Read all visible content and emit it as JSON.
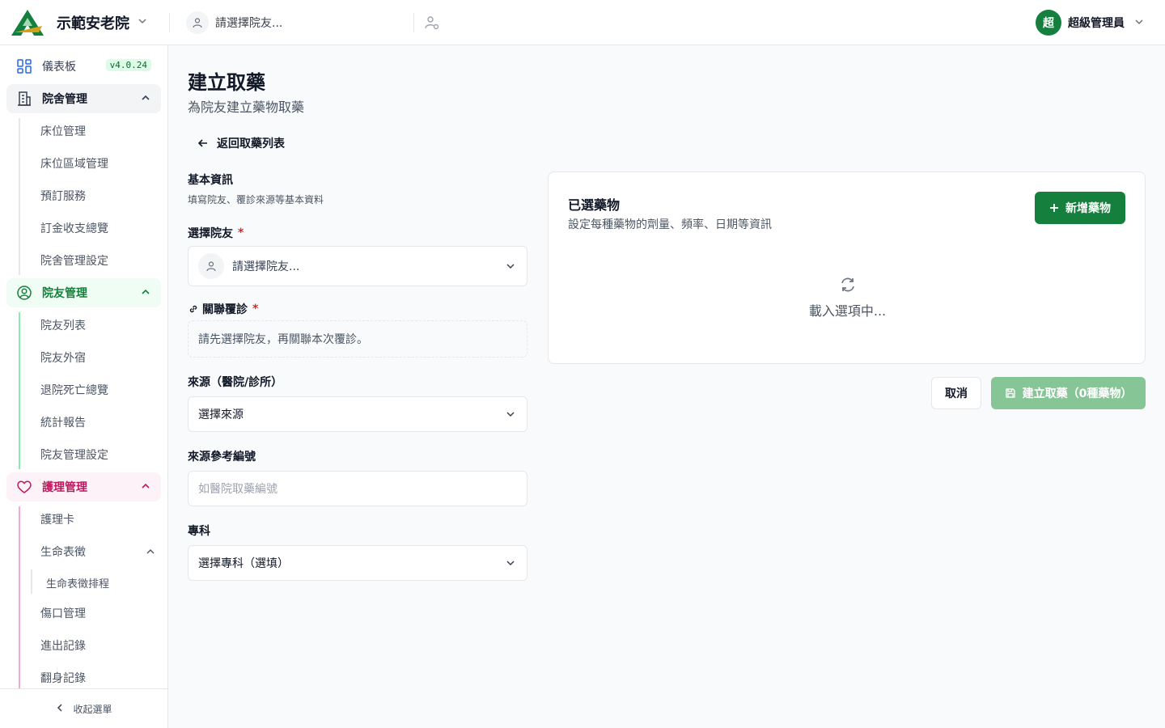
{
  "header": {
    "org_name": "示範安老院",
    "resident_placeholder": "請選擇院友...",
    "user_initial": "超",
    "user_name": "超級管理員"
  },
  "sidebar": {
    "dashboard": "儀表板",
    "version": "v4.0.24",
    "groups": [
      {
        "label": "院舍管理",
        "items": [
          "床位管理",
          "床位區域管理",
          "預訂服務",
          "訂金收支總覽",
          "院舍管理設定"
        ]
      },
      {
        "label": "院友管理",
        "items": [
          "院友列表",
          "院友外宿",
          "退院死亡總覽",
          "統計報告",
          "院友管理設定"
        ]
      },
      {
        "label": "護理管理",
        "items": [
          "護理卡",
          "生命表徵",
          "生命表徵排程",
          "傷口管理",
          "進出記錄",
          "翻身記錄"
        ]
      }
    ],
    "collapse_label": "收起選單"
  },
  "page": {
    "title": "建立取藥",
    "subtitle": "為院友建立藥物取藥",
    "back_label": "返回取藥列表"
  },
  "form": {
    "section_title": "基本資訊",
    "section_subtitle": "填寫院友、覆診來源等基本資料",
    "resident_label": "選擇院友",
    "resident_placeholder": "請選擇院友...",
    "followup_label": "關聯覆診",
    "followup_hint": "請先選擇院友，再關聯本次覆診。",
    "source_label": "來源（醫院/診所）",
    "source_value": "選擇來源",
    "ref_label": "來源參考編號",
    "ref_placeholder": "如醫院取藥編號",
    "specialty_label": "專科",
    "specialty_value": "選擇專科（選填）",
    "required_mark": "*"
  },
  "panel": {
    "title": "已選藥物",
    "subtitle": "設定每種藥物的劑量、頻率、日期等資訊",
    "add_button": "新增藥物",
    "loading": "載入選項中..."
  },
  "actions": {
    "cancel": "取消",
    "create": "建立取藥（0種藥物）"
  },
  "colors": {
    "primary": "#15803d",
    "primary_disabled": "#86c596",
    "facility": "#374151",
    "resident": "#15803d",
    "nursing": "#be185d"
  }
}
